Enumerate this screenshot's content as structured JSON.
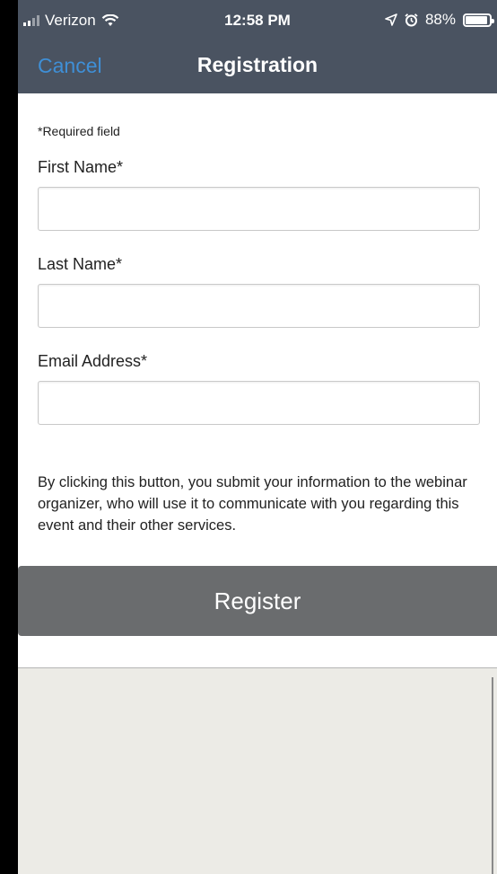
{
  "status_bar": {
    "carrier": "Verizon",
    "time": "12:58 PM",
    "battery": "88%"
  },
  "nav": {
    "cancel_label": "Cancel",
    "title": "Registration"
  },
  "form": {
    "required_note": "*Required field",
    "first_name_label": "First Name*",
    "first_name_value": "",
    "last_name_label": "Last Name*",
    "last_name_value": "",
    "email_label": "Email Address*",
    "email_value": ""
  },
  "disclaimer": "By clicking this button, you submit your information to the webinar organizer, who will use it to communicate with you regarding this event and their other services.",
  "register_label": "Register",
  "colors": {
    "header": "#4a5361",
    "cancel": "#3f8fd6",
    "register_button": "#6a6c6e",
    "bottom_pane": "#ecebe6"
  }
}
